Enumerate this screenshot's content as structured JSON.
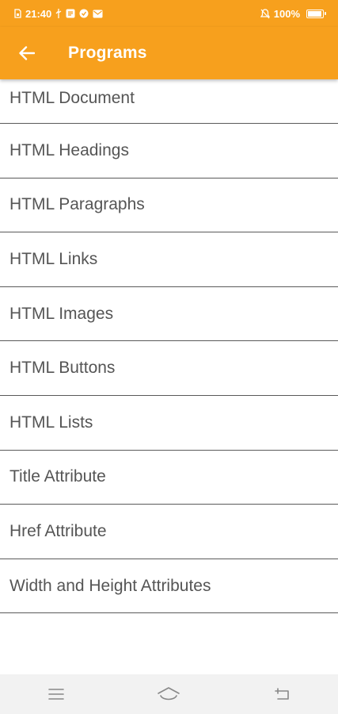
{
  "status_bar": {
    "time": "21:40",
    "battery_percent": "100%",
    "battery_level": 1.0,
    "icons": [
      "sim-icon",
      "usb-icon",
      "notification-icon",
      "check-icon",
      "mail-icon",
      "mute-icon",
      "battery-icon"
    ]
  },
  "app_bar": {
    "title": "Programs",
    "back_icon": "arrow-left-icon",
    "color": "#f7a01d"
  },
  "programs": [
    "HTML Document",
    "HTML Headings",
    "HTML Paragraphs",
    "HTML Links",
    "HTML Images",
    "HTML Buttons",
    "HTML Lists",
    "Title Attribute",
    "Href Attribute",
    "Width and Height Attributes"
  ],
  "nav_bar": {
    "icons": [
      "menu-icon",
      "home-icon",
      "back-icon"
    ]
  }
}
